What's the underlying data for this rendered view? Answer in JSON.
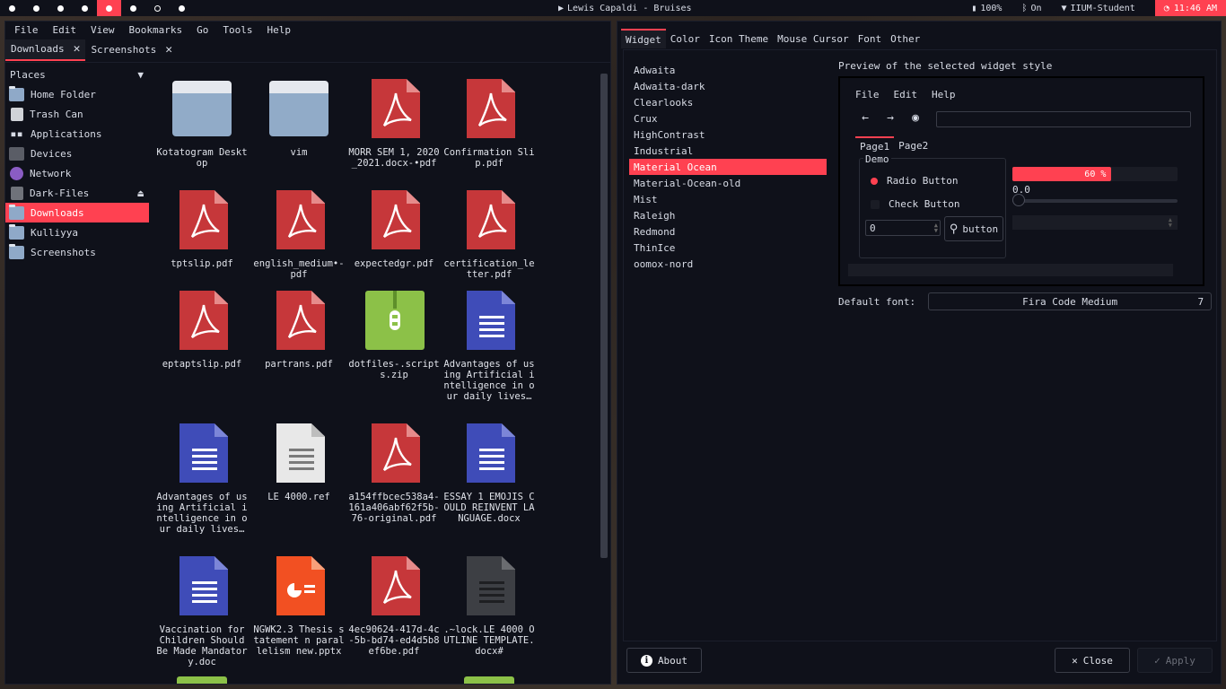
{
  "topbar": {
    "now_playing": "Lewis Capaldi - Bruises",
    "battery": "100%",
    "bluetooth": "On",
    "wifi": "IIUM-Student",
    "time": "11:46 AM"
  },
  "filemanager": {
    "menu": [
      "File",
      "Edit",
      "View",
      "Bookmarks",
      "Go",
      "Tools",
      "Help"
    ],
    "tabs": [
      "Downloads",
      "Screenshots"
    ],
    "places_title": "Places",
    "places": [
      "Home Folder",
      "Trash Can",
      "Applications",
      "Devices",
      "Network",
      "Dark-Files",
      "Downloads",
      "Kulliyya",
      "Screenshots"
    ],
    "files": [
      {
        "name": "Kotatogram Desktop",
        "type": "folder"
      },
      {
        "name": "vim",
        "type": "folder"
      },
      {
        "name": "MORR SEM 1, 2020_2021.docx-•pdf",
        "type": "pdf"
      },
      {
        "name": "Confirmation Slip.pdf",
        "type": "pdf"
      },
      {
        "name": "tptslip.pdf",
        "type": "pdf"
      },
      {
        "name": "english_medium•-pdf",
        "type": "pdf"
      },
      {
        "name": "expectedgr.pdf",
        "type": "pdf"
      },
      {
        "name": "certification_letter.pdf",
        "type": "pdf"
      },
      {
        "name": "eptaptslip.pdf",
        "type": "pdf"
      },
      {
        "name": "partrans.pdf",
        "type": "pdf"
      },
      {
        "name": "dotfiles-.scripts.zip",
        "type": "zip"
      },
      {
        "name": "Advantages of using Artificial intelligence in our daily lives…",
        "type": "doc"
      },
      {
        "name": "Advantages of using Artificial intelligence in our daily lives…",
        "type": "doc"
      },
      {
        "name": "LE 4000.ref",
        "type": "txt"
      },
      {
        "name": "a154ffbcec538a4-161a406abf62f5b-76-original.pdf",
        "type": "pdf"
      },
      {
        "name": "ESSAY 1 EMOJIS COULD REINVENT LANGUAGE.docx",
        "type": "doc"
      },
      {
        "name": "Vaccination for Children Should Be Made Mandatory.doc",
        "type": "doc"
      },
      {
        "name": "NGWK2.3 Thesis statement n parallelism new.pptx",
        "type": "ppt"
      },
      {
        "name": "4ec90624-417d-4c-5b-bd74-ed4d5b8ef6be.pdf",
        "type": "pdf"
      },
      {
        "name": ".~lock.LE 4000 OUTLINE TEMPLATE.docx#",
        "type": "dark"
      }
    ]
  },
  "settings": {
    "tabs": [
      "Widget",
      "Color",
      "Icon Theme",
      "Mouse Cursor",
      "Font",
      "Other"
    ],
    "themes": [
      "Adwaita",
      "Adwaita-dark",
      "Clearlooks",
      "Crux",
      "HighContrast",
      "Industrial",
      "Material Ocean",
      "Material-Ocean-old",
      "Mist",
      "Raleigh",
      "Redmond",
      "ThinIce",
      "oomox-nord"
    ],
    "selected_theme": "Material Ocean",
    "preview_label": "Preview of the selected widget style",
    "preview": {
      "menu": [
        "File",
        "Edit",
        "Help"
      ],
      "tabs": [
        "Page1",
        "Page2"
      ],
      "demo_label": "Demo",
      "radio_label": "Radio Button",
      "check_label": "Check Button",
      "spin_value": "0",
      "button_label": "button",
      "progress_text": "60 %",
      "progress": 0.6,
      "slider_value": "0.0"
    },
    "default_font_label": "Default font:",
    "font_name": "Fira Code Medium",
    "font_size": "7",
    "about": "About",
    "close": "Close",
    "apply": "Apply"
  }
}
